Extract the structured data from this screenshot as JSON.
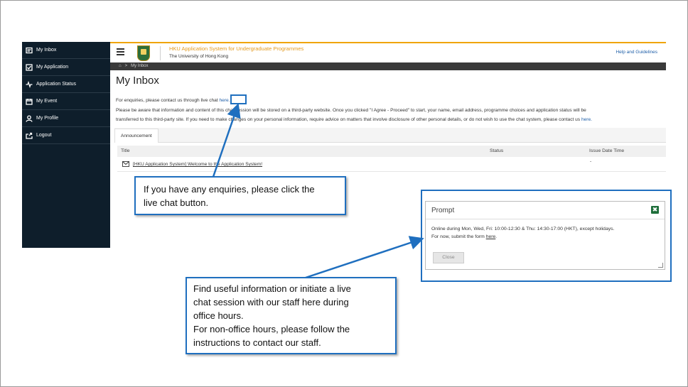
{
  "sidebar": {
    "items": [
      {
        "label": "My Inbox",
        "icon": "inbox-icon"
      },
      {
        "label": "My Application",
        "icon": "checkbox-icon"
      },
      {
        "label": "Application Status",
        "icon": "pulse-icon"
      },
      {
        "label": "My Event",
        "icon": "calendar-icon"
      },
      {
        "label": "My Profile",
        "icon": "user-icon"
      },
      {
        "label": "Logout",
        "icon": "logout-icon"
      }
    ]
  },
  "header": {
    "title": "HKU Application System for Undergraduate Programmes",
    "subtitle": "The University of Hong Kong",
    "help": "Help and Guidelines"
  },
  "breadcrumb": {
    "separator": ">",
    "current": "My Inbox"
  },
  "page": {
    "title": "My Inbox",
    "enquiry_text": "For enquiries, please contact us through live chat ",
    "enquiry_link": "here.",
    "notice_line1": "Please be aware that information and content of this chat session will be stored on a third-party website. Once you clicked \"I Agree - Proceed\" to start, your name, email address, programme choices and application status will be",
    "notice_line2": "transferred to this third-party site. If you need to make changes on your personal information, require advice on matters that involve disclosure of other personal details, or do not wish to use the chat system, please contact us ",
    "notice_link": "here."
  },
  "tabs": [
    {
      "label": "Announcement"
    }
  ],
  "table": {
    "columns": [
      "Title",
      "Status",
      "Issue Date Time"
    ],
    "rows": [
      {
        "title": "[HKU Application System] Welcome to the Application System!",
        "status": "",
        "date": "-"
      }
    ]
  },
  "callouts": {
    "top": [
      "If you have any enquiries, please click the",
      "live chat button."
    ],
    "bottom": [
      "Find useful information or initiate a live",
      "chat session with our staff here during",
      "office hours.",
      "For non-office hours, please follow the",
      "instructions to contact our staff."
    ]
  },
  "prompt": {
    "title": "Prompt",
    "close_icon": "✖",
    "line1": "Online during Mon, Wed, Fri: 10:00-12:30 & Thu: 14:30-17:00 (HKT), except holidays.",
    "line2_text": "For now, submit the form ",
    "line2_link": "here",
    "line2_end": ".",
    "close_button": "Close"
  },
  "colors": {
    "accent": "#1f6fbf",
    "brand": "#e39a1f",
    "sidebar": "#0e1e2b"
  }
}
